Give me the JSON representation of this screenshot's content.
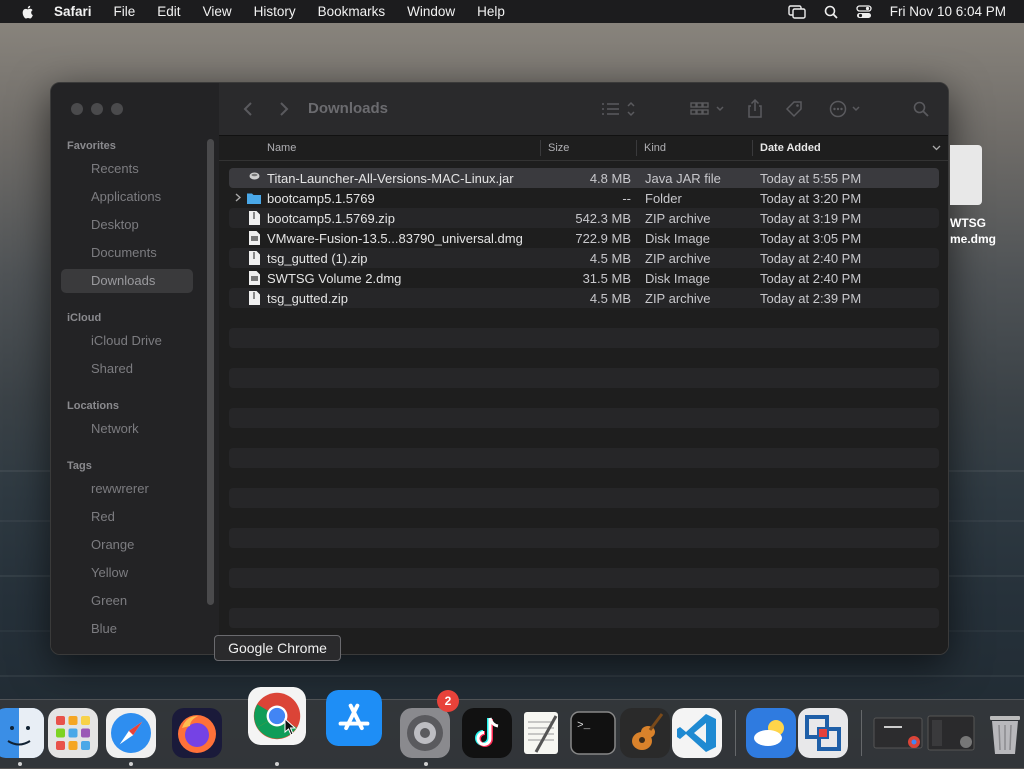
{
  "menubar": {
    "app_name": "Safari",
    "items": [
      "File",
      "Edit",
      "View",
      "History",
      "Bookmarks",
      "Window",
      "Help"
    ],
    "clock": "Fri Nov 10  6:04 PM"
  },
  "finder": {
    "title": "Downloads",
    "sidebar": {
      "favorites_header": "Favorites",
      "favorites": [
        "Recents",
        "Applications",
        "Desktop",
        "Documents",
        "Downloads"
      ],
      "icloud_header": "iCloud",
      "icloud": [
        "iCloud Drive",
        "Shared"
      ],
      "locations_header": "Locations",
      "locations": [
        "Network"
      ],
      "tags_header": "Tags",
      "tags": [
        "rewwrerer",
        "Red",
        "Orange",
        "Yellow",
        "Green",
        "Blue"
      ]
    },
    "columns": {
      "name": "Name",
      "size": "Size",
      "kind": "Kind",
      "date_added": "Date Added"
    },
    "files": [
      {
        "name": "Titan-Launcher-All-Versions-MAC-Linux.jar",
        "size": "4.8 MB",
        "kind": "Java JAR file",
        "date": "Today at 5:55 PM"
      },
      {
        "name": "bootcamp5.1.5769",
        "size": "--",
        "kind": "Folder",
        "date": "Today at 3:20 PM"
      },
      {
        "name": "bootcamp5.1.5769.zip",
        "size": "542.3 MB",
        "kind": "ZIP archive",
        "date": "Today at 3:19 PM"
      },
      {
        "name": "VMware-Fusion-13.5...83790_universal.dmg",
        "size": "722.9 MB",
        "kind": "Disk Image",
        "date": "Today at 3:05 PM"
      },
      {
        "name": "tsg_gutted (1).zip",
        "size": "4.5 MB",
        "kind": "ZIP archive",
        "date": "Today at 2:40 PM"
      },
      {
        "name": "SWTSG Volume 2.dmg",
        "size": "31.5 MB",
        "kind": "Disk Image",
        "date": "Today at 2:40 PM"
      },
      {
        "name": "tsg_gutted.zip",
        "size": "4.5 MB",
        "kind": "ZIP archive",
        "date": "Today at 2:39 PM"
      }
    ]
  },
  "desktop_file": {
    "line1": "WTSG",
    "line2": "me.dmg"
  },
  "tooltip": "Google Chrome",
  "dock": {
    "settings_badge": "2"
  }
}
